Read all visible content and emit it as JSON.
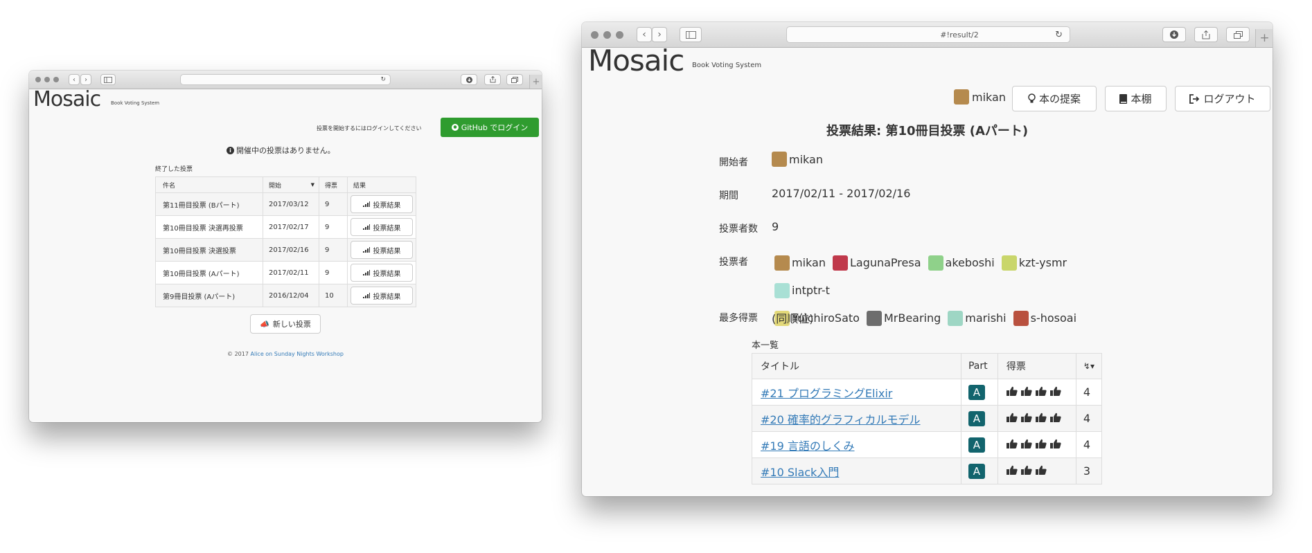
{
  "left": {
    "app": {
      "logo": "Mosaic",
      "tagline": "Book Voting System"
    },
    "login_hint": "投票を開始するにはログインしてください",
    "login_button": "GitHub でログイン",
    "no_active": "開催中の投票はありません。",
    "finished_label": "終了した投票",
    "table": {
      "headers": [
        "件名",
        "開始",
        "得票",
        "結果"
      ],
      "rows": [
        {
          "name": "第11冊目投票 (Bパート)",
          "start": "2017/03/12",
          "votes": "9",
          "result": "投票結果"
        },
        {
          "name": "第10冊目投票 決選再投票",
          "start": "2017/02/17",
          "votes": "9",
          "result": "投票結果"
        },
        {
          "name": "第10冊目投票 決選投票",
          "start": "2017/02/16",
          "votes": "9",
          "result": "投票結果"
        },
        {
          "name": "第10冊目投票 (Aパート)",
          "start": "2017/02/11",
          "votes": "9",
          "result": "投票結果"
        },
        {
          "name": "第9冊目投票 (Aパート)",
          "start": "2016/12/04",
          "votes": "10",
          "result": "投票結果"
        }
      ]
    },
    "new_vote_button": "新しい投票",
    "footer": {
      "copyright": "© 2017",
      "link": "Alice on Sunday Nights Workshop"
    }
  },
  "right": {
    "url": "#!result/2",
    "app": {
      "logo": "Mosaic",
      "tagline": "Book Voting System"
    },
    "user": "mikan",
    "nav": {
      "propose": "本の提案",
      "shelf": "本棚",
      "logout": "ログアウト"
    },
    "title": "投票結果: 第10冊目投票 (Aパート)",
    "fields": {
      "starter_label": "開始者",
      "starter": "mikan",
      "period_label": "期間",
      "period": "2017/02/11 - 2017/02/16",
      "voter_count_label": "投票者数",
      "voter_count": "9",
      "voters_label": "投票者",
      "top_label": "最多得票",
      "top": "(同順位)"
    },
    "voters": [
      "mikan",
      "LagunaPresa",
      "akeboshi",
      "kzt-ysmr",
      "intptr-t",
      "YuichiroSato",
      "MrBearing",
      "marishi",
      "s-hosoai"
    ],
    "voter_colors": [
      "#b58a4e",
      "#c0394b",
      "#8fd18a",
      "#c9d66b",
      "#a9e0d5",
      "#e3d97a",
      "#6d6d6d",
      "#9ed6c4",
      "#b9513f"
    ],
    "book_list_label": "本一覧",
    "book_table": {
      "headers": [
        "タイトル",
        "Part",
        "得票"
      ],
      "rows": [
        {
          "title": "#21 プログラミングElixir",
          "part": "A",
          "score": "4",
          "thumbs": 4
        },
        {
          "title": "#20 確率的グラフィカルモデル",
          "part": "A",
          "score": "4",
          "thumbs": 4
        },
        {
          "title": "#19 言語のしくみ",
          "part": "A",
          "score": "4",
          "thumbs": 4
        },
        {
          "title": "#10 Slack入門",
          "part": "A",
          "score": "3",
          "thumbs": 3
        }
      ]
    }
  }
}
